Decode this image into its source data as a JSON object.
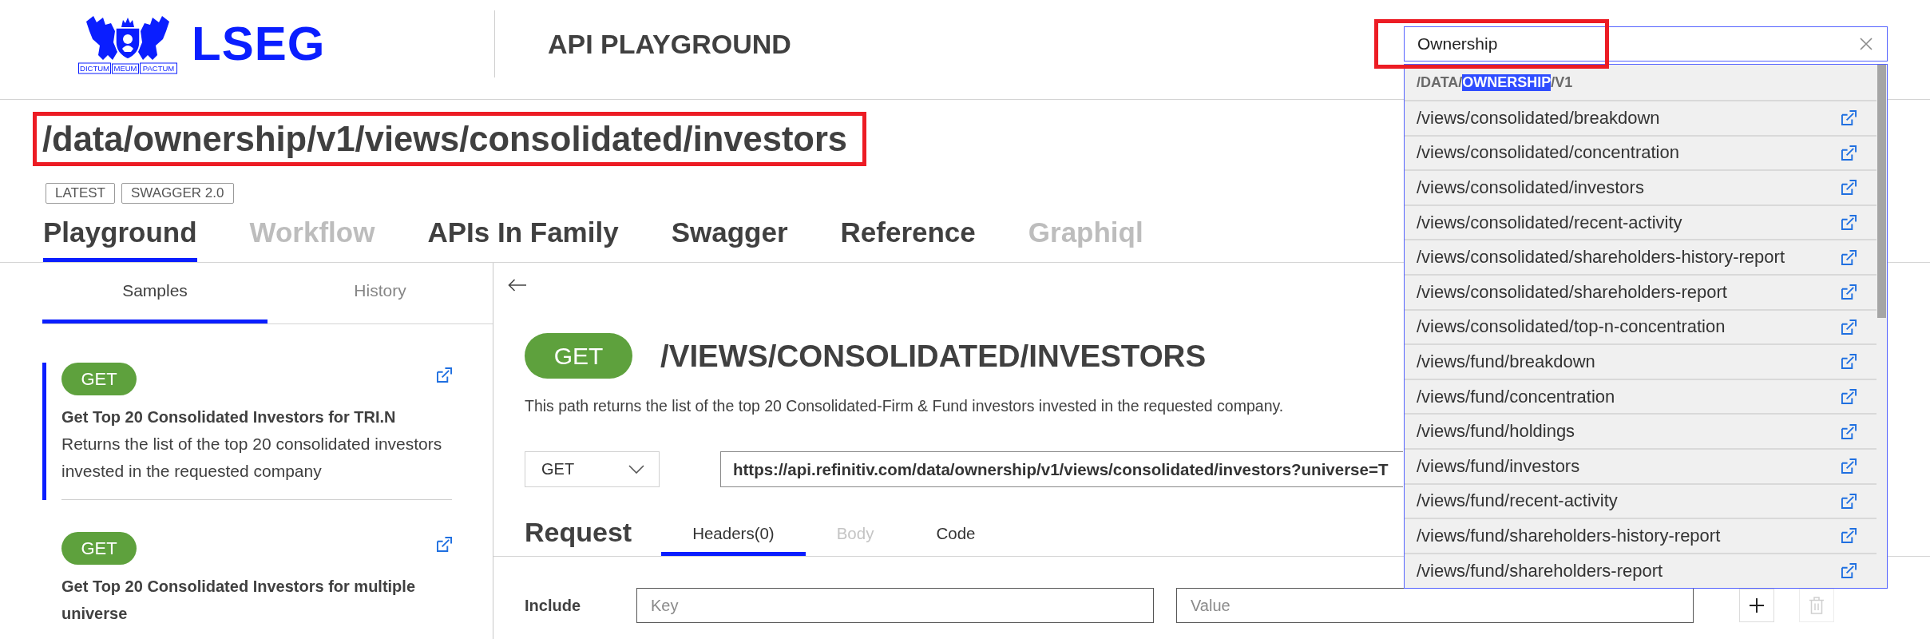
{
  "header": {
    "logo": {
      "wordmark": "LSEG",
      "motto": [
        "DICTUM",
        "MEUM",
        "PACTUM"
      ]
    },
    "app_name": "API PLAYGROUND",
    "search": {
      "value": "Ownership",
      "framed": true,
      "results": {
        "group": [
          {
            "text": "/DATA/",
            "highlighted": false
          },
          {
            "text": "OWNERSHIP",
            "highlighted": true
          },
          {
            "text": "/V1",
            "highlighted": false
          }
        ],
        "items": [
          "/views/consolidated/breakdown",
          "/views/consolidated/concentration",
          "/views/consolidated/investors",
          "/views/consolidated/recent-activity",
          "/views/consolidated/shareholders-history-report",
          "/views/consolidated/shareholders-report",
          "/views/consolidated/top-n-concentration",
          "/views/fund/breakdown",
          "/views/fund/concentration",
          "/views/fund/holdings",
          "/views/fund/investors",
          "/views/fund/recent-activity",
          "/views/fund/shareholders-history-report",
          "/views/fund/shareholders-report"
        ]
      }
    }
  },
  "page": {
    "title": "/data/ownership/v1/views/consolidated/investors",
    "title_framed": true,
    "badges": [
      "LATEST",
      "SWAGGER 2.0"
    ],
    "tabs": [
      {
        "label": "Playground",
        "selected": true,
        "disabled": false
      },
      {
        "label": "Workflow",
        "selected": false,
        "disabled": true
      },
      {
        "label": "APIs In Family",
        "selected": false,
        "disabled": false
      },
      {
        "label": "Swagger",
        "selected": false,
        "disabled": false
      },
      {
        "label": "Reference",
        "selected": false,
        "disabled": false
      },
      {
        "label": "Graphiql",
        "selected": false,
        "disabled": true
      }
    ]
  },
  "samples_panel": {
    "tabs": [
      {
        "label": "Samples",
        "selected": true
      },
      {
        "label": "History",
        "selected": false
      }
    ],
    "samples": [
      {
        "method": "GET",
        "title": "Get Top 20 Consolidated Investors for TRI.N",
        "description": "Returns the list of the top 20 consolidated investors invested in the requested company",
        "selected": true
      },
      {
        "method": "GET",
        "title": "Get Top 20 Consolidated Investors for multiple universe",
        "selected": false
      }
    ]
  },
  "endpoint": {
    "method": "GET",
    "path": "/VIEWS/CONSOLIDATED/INVESTORS",
    "description": "This path returns the list of the top 20 Consolidated-Firm & Fund investors invested in the requested company.",
    "request_method": "GET",
    "url": "https://api.refinitiv.com/data/ownership/v1/views/consolidated/investors?universe=T",
    "request": {
      "title": "Request",
      "tabs": [
        {
          "label": "Headers(0)",
          "selected": true,
          "disabled": false
        },
        {
          "label": "Body",
          "selected": false,
          "disabled": true
        },
        {
          "label": "Code",
          "selected": false,
          "disabled": false
        }
      ],
      "include_row": {
        "label": "Include",
        "key_placeholder": "Key",
        "value_placeholder": "Value",
        "buttons": [
          {
            "kind": "add",
            "disabled": false
          },
          {
            "kind": "delete",
            "disabled": true
          }
        ]
      }
    }
  }
}
